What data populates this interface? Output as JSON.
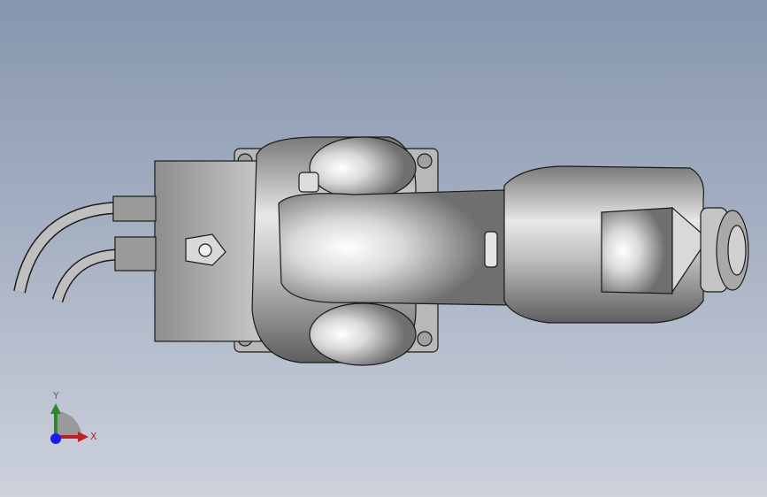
{
  "viewport": {
    "background_top": "#8796ad",
    "background_bottom": "#cdd2dc",
    "model_color": "#c9c9c9",
    "edge_color": "#1a1a1a"
  },
  "triad": {
    "y_label": "Y",
    "x_label": "X",
    "y_color": "#2a8a2a",
    "x_color": "#c02020",
    "origin_color": "#1a1aff",
    "icon": "coordinate-triad-icon"
  }
}
